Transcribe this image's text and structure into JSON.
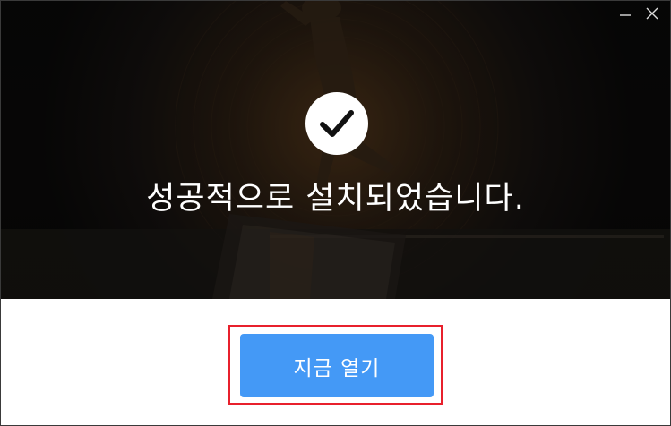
{
  "window": {
    "controls": {
      "minimize_icon": "minimize-icon",
      "close_icon": "close-icon"
    }
  },
  "hero": {
    "icon": "checkmark-icon",
    "message": "성공적으로 설치되었습니다."
  },
  "actions": {
    "open_label": "지금 열기"
  },
  "colors": {
    "button_bg": "#4499f6",
    "highlight_border": "#e8202c",
    "hero_bg": "#0b0a09",
    "text_light": "#ffffff"
  }
}
